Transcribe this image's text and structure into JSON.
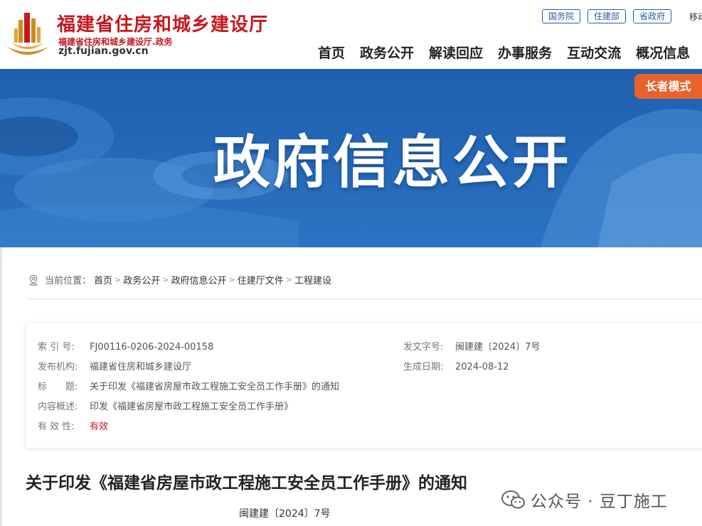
{
  "site": {
    "title": "福建省住房和城乡建设厅",
    "subtitle": "福建省住房和城乡建设厅.政务",
    "domain": "zjt.fujian.gov.cn"
  },
  "top_links": [
    "国务院",
    "住建部",
    "省政府"
  ],
  "top_extra": "移动",
  "nav": [
    "首页",
    "政务公开",
    "解读回应",
    "办事服务",
    "互动交流",
    "概况信息"
  ],
  "banner": {
    "title": "政府信息公开",
    "elder_mode": "长者模式",
    "colors": {
      "primary": "#1c5fa9",
      "accent": "#e8622c"
    }
  },
  "breadcrumb": {
    "label": "当前位置：",
    "items": [
      "首页",
      "政务公开",
      "政府信息公开",
      "住建厅文件",
      "工程建设"
    ],
    "icon": "location-pin-icon"
  },
  "info": {
    "index_key": "索 引 号:",
    "index_val": "FJ00116-0206-2024-00158",
    "issuer_key": "发布机构:",
    "issuer_val": "福建省住房和城乡建设厅",
    "title_key": "标　　题:",
    "title_val": "关于印发《福建省房屋市政工程施工安全员工作手册》的通知",
    "summary_key": "内容概述:",
    "summary_val": "印发《福建省房屋市政工程施工安全员工作手册》",
    "validity_key": "有 效 性:",
    "validity_val": "有效",
    "docno_key": "发文字号:",
    "docno_val": "闽建建〔2024〕7号",
    "date_key": "生成日期:",
    "date_val": "2024-08-12"
  },
  "document": {
    "title": "关于印发《福建省房屋市政工程施工安全员工作手册》的通知",
    "number": "闽建建〔2024〕7号"
  },
  "watermark": {
    "text": "公众号 · 豆丁施工",
    "icon": "wechat-icon"
  }
}
